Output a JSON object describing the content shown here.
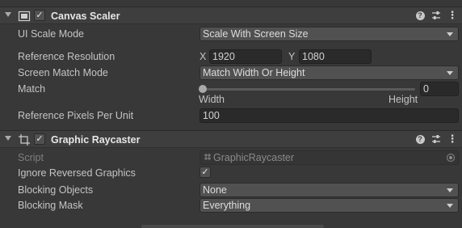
{
  "canvas_scaler": {
    "title": "Canvas Scaler",
    "enabled_mark": "✓",
    "ui_scale_mode": {
      "label": "UI Scale Mode",
      "value": "Scale With Screen Size"
    },
    "reference_resolution": {
      "label": "Reference Resolution",
      "x_label": "X",
      "x_value": "1920",
      "y_label": "Y",
      "y_value": "1080"
    },
    "screen_match_mode": {
      "label": "Screen Match Mode",
      "value": "Match Width Or Height"
    },
    "match": {
      "label": "Match",
      "value": "0",
      "slider_fraction": 0,
      "min_label": "Width",
      "max_label": "Height"
    },
    "reference_pixels_per_unit": {
      "label": "Reference Pixels Per Unit",
      "value": "100"
    }
  },
  "graphic_raycaster": {
    "title": "Graphic Raycaster",
    "enabled_mark": "✓",
    "script": {
      "label": "Script",
      "value": "GraphicRaycaster"
    },
    "ignore_reversed_graphics": {
      "label": "Ignore Reversed Graphics",
      "checked_mark": "✓"
    },
    "blocking_objects": {
      "label": "Blocking Objects",
      "value": "None"
    },
    "blocking_mask": {
      "label": "Blocking Mask",
      "value": "Everything"
    }
  },
  "header_buttons": {
    "help": "?",
    "menu": "⋮"
  },
  "icons": [
    "canvas-scaler-icon",
    "graphic-raycaster-icon",
    "help-icon",
    "presets-icon",
    "menu-icon",
    "object-picker-icon"
  ],
  "colors": {
    "background": "#383838",
    "header": "#3e3e3e",
    "field": "#2a2a2a",
    "dropdown": "#515151",
    "text": "#c4c4c4"
  }
}
